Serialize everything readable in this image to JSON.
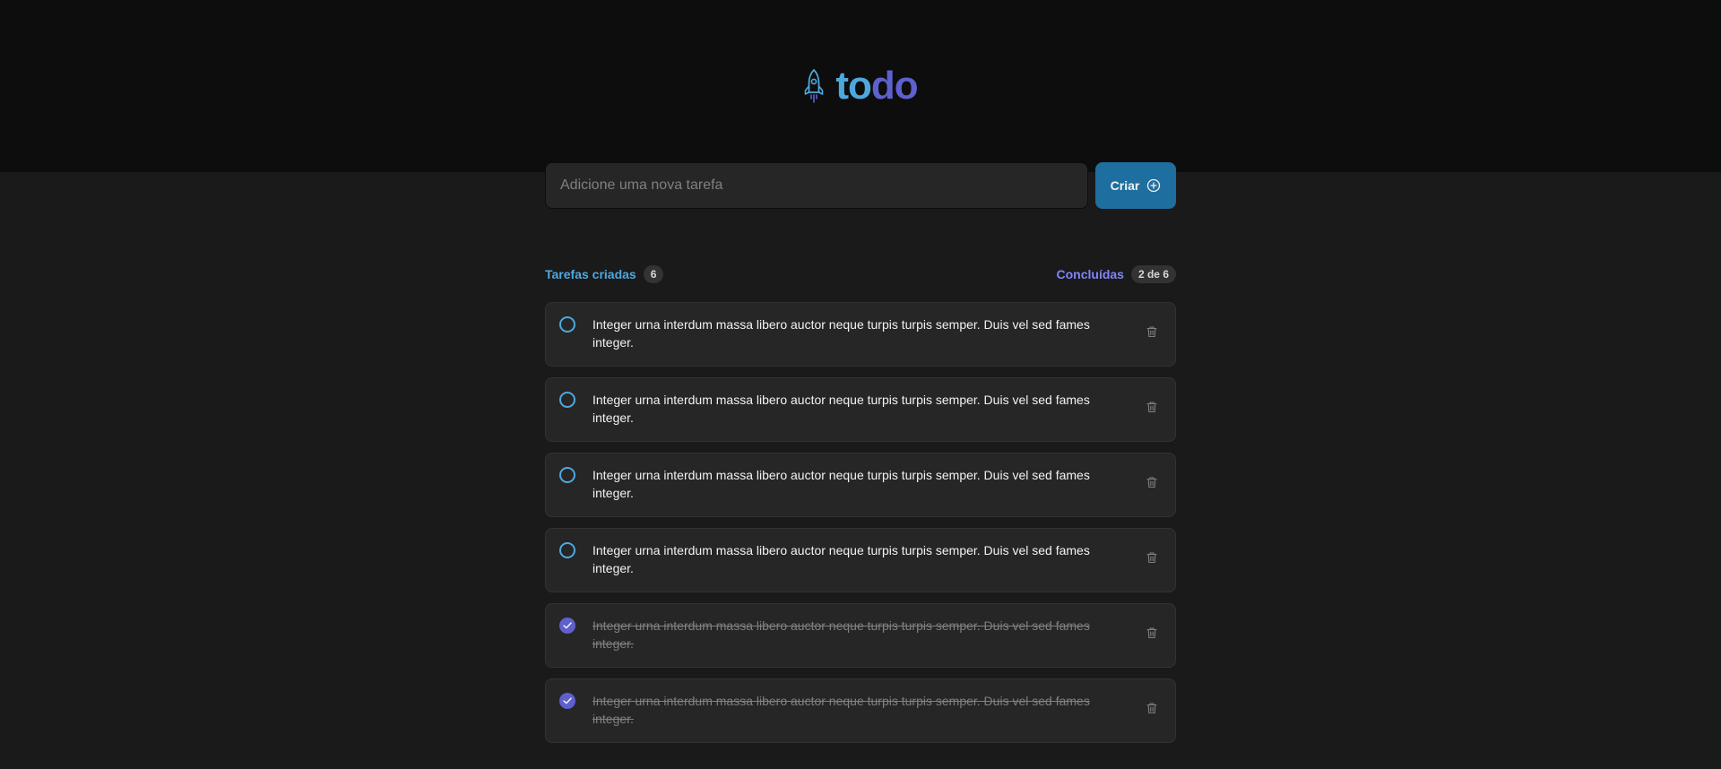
{
  "header": {
    "logo_icon": "rocket-icon",
    "logo_part1": "to",
    "logo_part2": "do"
  },
  "form": {
    "placeholder": "Adicione uma nova tarefa",
    "value": "",
    "create_label": "Criar",
    "create_icon": "plus-circle-icon"
  },
  "counters": {
    "created_label": "Tarefas criadas",
    "created_count": "6",
    "done_label": "Concluídas",
    "done_count": "2 de 6"
  },
  "tasks": [
    {
      "text": "Integer urna interdum massa libero auctor neque turpis turpis semper. Duis vel sed fames integer.",
      "done": false
    },
    {
      "text": "Integer urna interdum massa libero auctor neque turpis turpis semper. Duis vel sed fames integer.",
      "done": false
    },
    {
      "text": "Integer urna interdum massa libero auctor neque turpis turpis semper. Duis vel sed fames integer.",
      "done": false
    },
    {
      "text": "Integer urna interdum massa libero auctor neque turpis turpis semper. Duis vel sed fames integer.",
      "done": false
    },
    {
      "text": "Integer urna interdum massa libero auctor neque turpis turpis semper. Duis vel sed fames integer.",
      "done": true
    },
    {
      "text": "Integer urna interdum massa libero auctor neque turpis turpis semper. Duis vel sed fames integer.",
      "done": true
    }
  ],
  "colors": {
    "blue": "#4ea8de",
    "blue_dark": "#1e6f9f",
    "purple": "#5e60ce",
    "purple_light": "#8284fa",
    "gray_700": "#0d0d0d",
    "gray_600": "#1a1a1a",
    "gray_500": "#262626",
    "gray_400": "#333333",
    "gray_300": "#808080"
  }
}
